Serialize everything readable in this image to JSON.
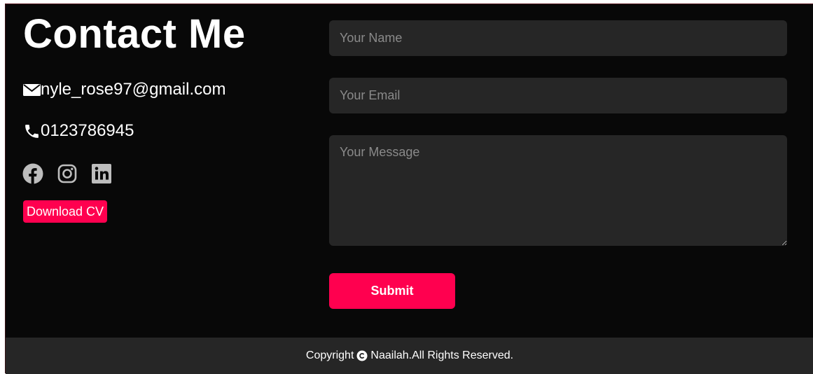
{
  "contact": {
    "title": "Contact Me",
    "email": "nyle_rose97@gmail.com",
    "phone": "0123786945",
    "email_icon": "envelope-icon",
    "phone_icon": "phone-icon",
    "social": [
      {
        "name": "facebook",
        "icon": "facebook-icon"
      },
      {
        "name": "instagram",
        "icon": "instagram-icon"
      },
      {
        "name": "linkedin",
        "icon": "linkedin-icon"
      }
    ],
    "download_cv_label": "Download CV"
  },
  "form": {
    "name_placeholder": "Your Name",
    "email_placeholder": "Your Email",
    "message_placeholder": "Your Message",
    "submit_label": "Submit"
  },
  "footer": {
    "prefix": "Copyright",
    "suffix": "Naailah.All Rights Reserved.",
    "icon": "copyright-icon"
  },
  "colors": {
    "background": "#080808",
    "accent": "#ff004f",
    "field_bg": "#262626",
    "footer_bg": "#262626",
    "text": "#ffffff",
    "placeholder": "#8a8a8a"
  }
}
